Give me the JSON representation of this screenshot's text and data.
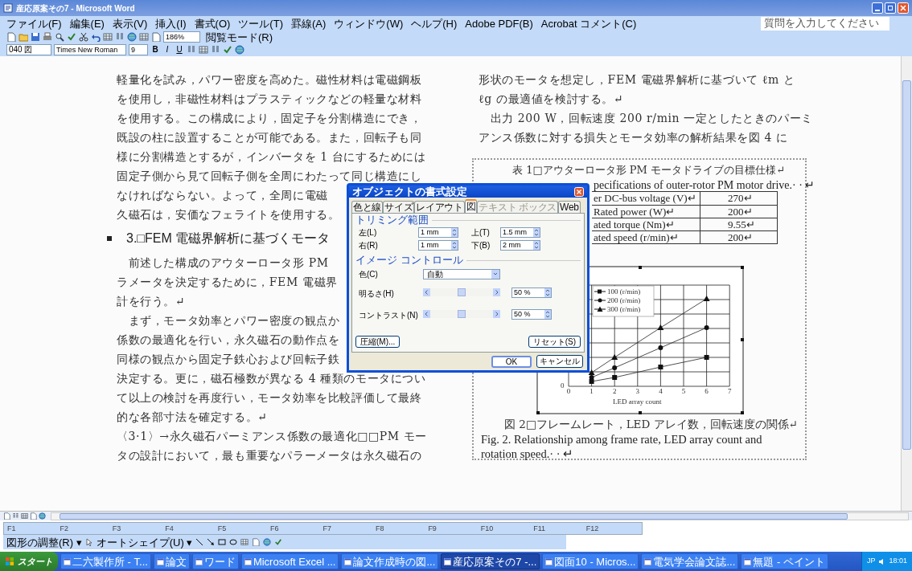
{
  "window": {
    "title": "産応原案その7 - Microsoft Word"
  },
  "menu": [
    "ファイル(F)",
    "編集(E)",
    "表示(V)",
    "挿入(I)",
    "書式(O)",
    "ツール(T)",
    "罫線(A)",
    "ウィンドウ(W)",
    "ヘルプ(H)",
    "Adobe PDF(B)",
    "Acrobat コメント(C)"
  ],
  "help_box": {
    "placeholder": "質問を入力してください"
  },
  "standard_toolbar": {
    "zoom": "186%",
    "reading_mode": "閲覧モード(R)"
  },
  "format_toolbar": {
    "style": "040 図",
    "font": "Times New Roman",
    "size": "9",
    "buttons": [
      "B",
      "I",
      "U"
    ]
  },
  "left_column": [
    {
      "kind": "line",
      "text": "軽量化を試み，パワー密度を高めた。磁性材料は電磁鋼板"
    },
    {
      "kind": "line",
      "text": "を使用し，非磁性材料はプラスティックなどの軽量な材料"
    },
    {
      "kind": "line",
      "text": "を使用する。この構成により，固定子を分割構造にでき，"
    },
    {
      "kind": "line",
      "text": "既設の柱に設置することが可能である。また，回転子も同"
    },
    {
      "kind": "line",
      "text": "様に分割構造とするが，インバータを 1 台にするためには"
    },
    {
      "kind": "line",
      "text": "固定子側から見て回転子側を全周にわたって同じ構造にし"
    },
    {
      "kind": "line",
      "text": "なければならない。よって，全周に電磁"
    },
    {
      "kind": "line",
      "text": "久磁石は，安価なフェライトを使用する。"
    },
    {
      "kind": "heading",
      "text": "3.□FEM 電磁界解析に基づくモータ"
    },
    {
      "kind": "line",
      "text": "　前述した構成のアウターロータ形 PM"
    },
    {
      "kind": "line",
      "text": "ラメータを決定するために，FEM 電磁界"
    },
    {
      "kind": "line",
      "text": "計を行う。↵"
    },
    {
      "kind": "line",
      "text": "　まず，モータ効率とパワー密度の観点か"
    },
    {
      "kind": "line",
      "text": "係数の最適化を行い，永久磁石の動作点を"
    },
    {
      "kind": "line",
      "text": "同様の観点から固定子鉄心および回転子鉄"
    },
    {
      "kind": "line",
      "text": "決定する。更に，磁石極数が異なる 4 種類のモータについ"
    },
    {
      "kind": "line",
      "text": "て以上の検討を再度行い，モータ効率を比較評価して最終"
    },
    {
      "kind": "line",
      "text": "的な各部寸法を確定する。↵"
    },
    {
      "kind": "line",
      "text": "〈3·1〉→永久磁石パーミアンス係数の最適化□□PM モー"
    },
    {
      "kind": "line",
      "text": "タの設計において，最も重要なパラーメータは永久磁石の"
    }
  ],
  "right_column": {
    "lines": [
      "形状のモータを想定し，FEM 電磁界解析に基づいて ℓm と",
      "ℓg の最適値を検討する。↵",
      "　出力 200 W，回転速度 200 r/min 一定としたときのパーミ",
      "アンス係数に対する損失とモータ効率の解析結果を図 4 に"
    ],
    "table_caption": "表 1□アウターロータ形 PM モータドライブの目標仕様↵",
    "table_caption_en": "pecifications of outer-rotor PM motor drive.· · ↵",
    "table_rows": [
      [
        "er DC-bus voltage (V)↵",
        "270↵"
      ],
      [
        "Rated power (W)↵",
        "200↵"
      ],
      [
        "ated torque (Nm)↵",
        "9.55↵"
      ],
      [
        "ated speed (r/min)↵",
        "200↵"
      ]
    ],
    "chart": {
      "legend": [
        "100 (r/min)",
        "200 (r/min)",
        "300 (r/min)"
      ],
      "x_ticks": [
        "0",
        "1",
        "2",
        "3",
        "4",
        "5",
        "6",
        "7"
      ],
      "y_tick": "0",
      "xlabel": "LED array count"
    },
    "figure_caption": "図 2□フレームレート，LED アレイ数，回転速度の関係↵",
    "figure_caption_en": [
      "Fig. 2. Relationship among frame rate, LED array count and",
      "rotation speed.· · ↵"
    ]
  },
  "dialog": {
    "title": "オブジェクトの書式設定",
    "tabs": [
      {
        "label": "色と線",
        "selected": false,
        "disabled": false
      },
      {
        "label": "サイズ",
        "selected": false,
        "disabled": false
      },
      {
        "label": "レイアウト",
        "selected": false,
        "disabled": false
      },
      {
        "label": "図",
        "selected": true,
        "disabled": false
      },
      {
        "label": "テキスト ボックス",
        "selected": false,
        "disabled": true
      },
      {
        "label": "Web",
        "selected": false,
        "disabled": false
      }
    ],
    "crop_title": "トリミング範囲",
    "crop": [
      {
        "label": "左(L)",
        "value": "1 mm"
      },
      {
        "label": "上(T)",
        "value": "1.5 mm"
      },
      {
        "label": "右(R)",
        "value": "1 mm"
      },
      {
        "label": "下(B)",
        "value": "2 mm"
      }
    ],
    "image_title": "イメージ コントロール",
    "color": {
      "label": "色(C)",
      "value": "自動"
    },
    "sliders": [
      {
        "label": "明るさ(H)",
        "level": 0.5,
        "value": "50 %"
      },
      {
        "label": "コントラスト(N)",
        "level": 0.5,
        "value": "50 %"
      }
    ],
    "compress": "圧縮(M)...",
    "reset": "リセット(S)",
    "ok": "OK",
    "cancel": "キャンセル"
  },
  "function_keys": [
    "F1",
    "F2",
    "F3",
    "F4",
    "F5",
    "F6",
    "F7",
    "F8",
    "F9",
    "F10",
    "F11",
    "F12"
  ],
  "drawing_toolbar": {
    "draw": "図形の調整(R) ▾",
    "autoshape": "オートシェイプ(U) ▾"
  },
  "taskbar": {
    "start": "スタート",
    "items": [
      {
        "label": "二六製作所 - T...",
        "selected": false
      },
      {
        "label": "論文",
        "selected": false
      },
      {
        "label": "ワード",
        "selected": false
      },
      {
        "label": "Microsoft Excel ...",
        "selected": false
      },
      {
        "label": "論文作成時の図...",
        "selected": false
      },
      {
        "label": "産応原案その7 -...",
        "selected": true
      },
      {
        "label": "図面10 - Micros...",
        "selected": false
      },
      {
        "label": "電気学会論文誌...",
        "selected": false
      },
      {
        "label": "無題 - ペイント",
        "selected": false
      }
    ],
    "language": "JP",
    "clock": "18:01"
  }
}
